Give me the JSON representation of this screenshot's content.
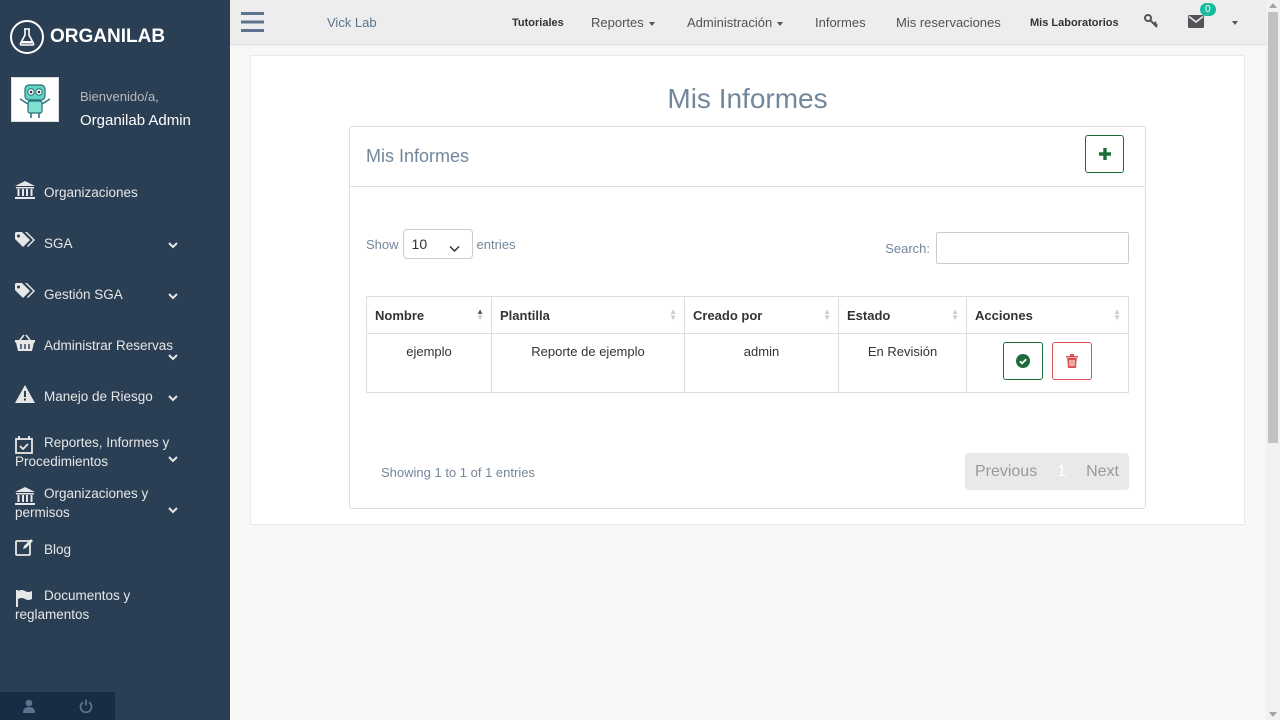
{
  "brand": {
    "name": "ORGANILAB"
  },
  "profile": {
    "welcome": "Bienvenido/a,",
    "name": "Organilab Admin"
  },
  "sidebar": {
    "items": [
      {
        "label": "Organizaciones"
      },
      {
        "label": "SGA"
      },
      {
        "label": "Gestión SGA"
      },
      {
        "label": "Administrar Reservas"
      },
      {
        "label": "Manejo de Riesgo"
      },
      {
        "label": "Reportes, Informes y Procedimientos"
      },
      {
        "label": "Organizaciones y permisos"
      },
      {
        "label": "Blog"
      },
      {
        "label": "Documentos y reglamentos"
      }
    ]
  },
  "topnav": {
    "lab": "Vick Lab",
    "links": [
      "Tutoriales",
      "Reportes",
      "Administración",
      "Informes",
      "Mis reservaciones",
      "Mis Laboratorios"
    ],
    "notifications": "0"
  },
  "page": {
    "title": "Mis Informes",
    "card_title": "Mis Informes",
    "length": {
      "show": "Show",
      "value": "10",
      "entries": "entries"
    },
    "search_label": "Search:",
    "table": {
      "headers": [
        "Nombre",
        "Plantilla",
        "Creado por",
        "Estado",
        "Acciones"
      ],
      "rows": [
        [
          "ejemplo",
          "Reporte de ejemplo",
          "admin",
          "En Revisión"
        ]
      ]
    },
    "info": "Showing 1 to 1 of 1 entries",
    "pagination": {
      "previous": "Previous",
      "page": "1",
      "next": "Next"
    }
  },
  "colors": {
    "sidebar": "#2a3f54",
    "accent_green": "#1d6b3a",
    "danger": "#d9534f",
    "badge": "#1abb9c"
  }
}
